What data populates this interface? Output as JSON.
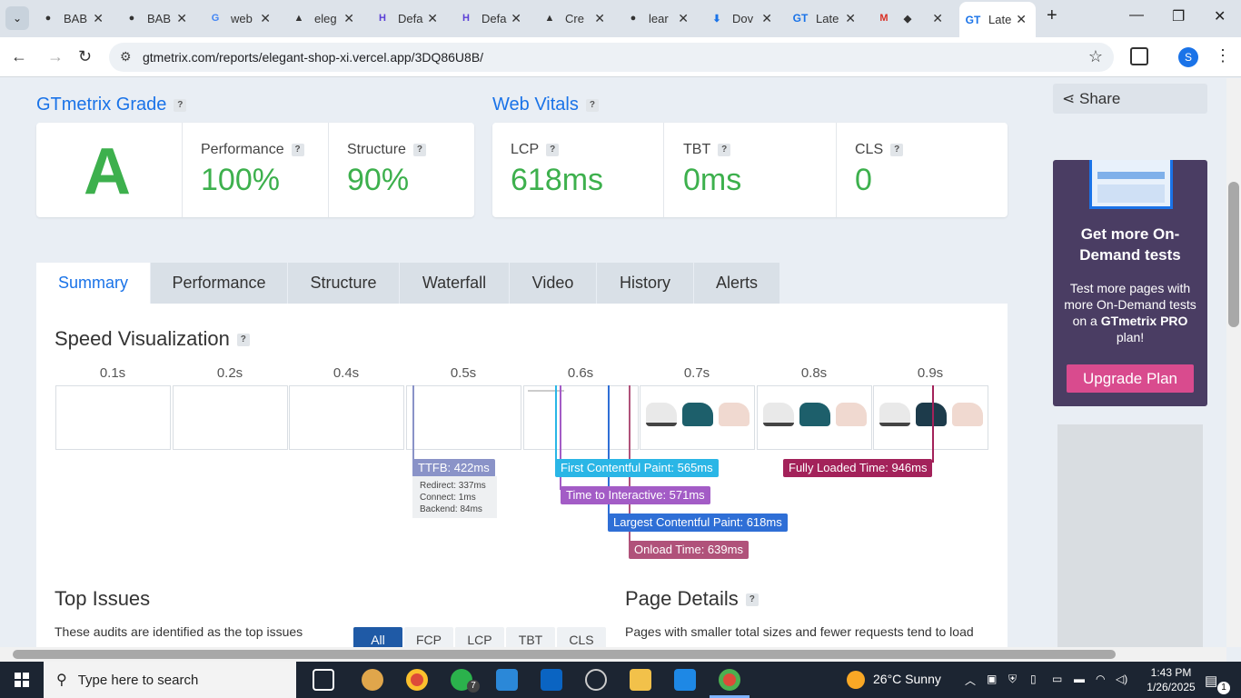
{
  "browser": {
    "tabs": [
      {
        "title": "BAB",
        "icon": "github-icon"
      },
      {
        "title": "BAB",
        "icon": "github-icon"
      },
      {
        "title": "web",
        "icon": "google-icon"
      },
      {
        "title": "eleg",
        "icon": "vercel-icon"
      },
      {
        "title": "Defa",
        "icon": "hygraph-icon"
      },
      {
        "title": "Defa",
        "icon": "hygraph-icon"
      },
      {
        "title": "Cre",
        "icon": "vercel-icon"
      },
      {
        "title": "lear",
        "icon": "github-icon"
      },
      {
        "title": "Dov",
        "icon": "download-icon"
      },
      {
        "title": "Late",
        "icon": "gtmetrix-icon"
      },
      {
        "title": "",
        "icon": "gmail-icon"
      },
      {
        "title": "Late",
        "icon": "gtmetrix-icon"
      }
    ],
    "url": "gtmetrix.com/reports/elegant-shop-xi.vercel.app/3DQ86U8B/",
    "profile_initial": "S"
  },
  "grade": {
    "title": "GTmetrix Grade",
    "letter": "A",
    "performance_label": "Performance",
    "performance_value": "100%",
    "structure_label": "Structure",
    "structure_value": "90%"
  },
  "vitals": {
    "title": "Web Vitals",
    "lcp_label": "LCP",
    "lcp_value": "618ms",
    "tbt_label": "TBT",
    "tbt_value": "0ms",
    "cls_label": "CLS",
    "cls_value": "0"
  },
  "report_tabs": [
    "Summary",
    "Performance",
    "Structure",
    "Waterfall",
    "Video",
    "History",
    "Alerts"
  ],
  "speed": {
    "title": "Speed Visualization",
    "times": [
      "0.1s",
      "0.2s",
      "0.4s",
      "0.5s",
      "0.6s",
      "0.7s",
      "0.8s",
      "0.9s"
    ],
    "markers": {
      "ttfb": "TTFB: 422ms",
      "redirect": "Redirect: 337ms",
      "connect": "Connect: 1ms",
      "backend": "Backend: 84ms",
      "fcp": "First Contentful Paint: 565ms",
      "tti": "Time to Interactive: 571ms",
      "lcp": "Largest Contentful Paint: 618ms",
      "onload": "Onload Time: 639ms",
      "fully": "Fully Loaded Time: 946ms"
    },
    "colors": {
      "ttfb": "#8a93c8",
      "fcp": "#2ab6e6",
      "tti": "#a35cc6",
      "lcp": "#2f6fd6",
      "onload": "#b0527a",
      "fully": "#a3225a"
    }
  },
  "top_issues": {
    "title": "Top Issues",
    "desc": "These audits are identified as the top issues",
    "filters": [
      "All",
      "FCP",
      "LCP",
      "TBT",
      "CLS"
    ]
  },
  "page_details": {
    "title": "Page Details",
    "desc": "Pages with smaller total sizes and fewer requests tend to load"
  },
  "sidebar": {
    "share": "Share",
    "promo_title": "Get more On-Demand tests",
    "promo_text_1": "Test more pages with more On-Demand tests on a ",
    "promo_brand": "GTmetrix PRO",
    "promo_text_2": " plan!",
    "upgrade": "Upgrade Plan"
  },
  "taskbar": {
    "search_placeholder": "Type here to search",
    "weather": "26°C  Sunny",
    "time": "1:43 PM",
    "date": "1/26/2025",
    "notif_count": "1",
    "whatsapp_badge": "7"
  }
}
